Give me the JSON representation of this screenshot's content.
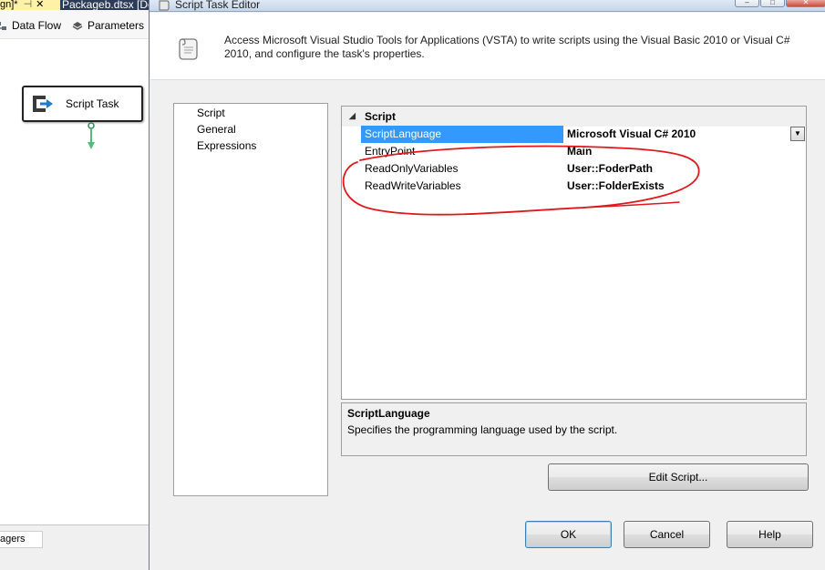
{
  "ide": {
    "tabs": [
      {
        "label": "gn]*"
      },
      {
        "label": "Packageb.dtsx [De"
      }
    ],
    "toolbar": {
      "data_flow": "Data Flow",
      "parameters": "Parameters"
    },
    "task": {
      "label": "Script Task"
    },
    "bottom_tab": "agers"
  },
  "dialog": {
    "title": "Script Task Editor",
    "description": "Access Microsoft Visual Studio Tools for Applications (VSTA) to write scripts using the Visual Basic 2010 or Visual C# 2010, and configure the task's properties.",
    "nav_items": [
      {
        "label": "Script"
      },
      {
        "label": "General"
      },
      {
        "label": "Expressions"
      }
    ],
    "grid": {
      "category": "Script",
      "rows": [
        {
          "name": "ScriptLanguage",
          "value": "Microsoft Visual C# 2010",
          "selected": true
        },
        {
          "name": "EntryPoint",
          "value": "Main"
        },
        {
          "name": "ReadOnlyVariables",
          "value": "User::FoderPath"
        },
        {
          "name": "ReadWriteVariables",
          "value": "User::FolderExists"
        }
      ]
    },
    "help": {
      "title": "ScriptLanguage",
      "text": "Specifies the programming language used by the script."
    },
    "buttons": {
      "edit_script": "Edit Script...",
      "ok": "OK",
      "cancel": "Cancel",
      "help": "Help"
    }
  },
  "colors": {
    "selection": "#3399ff",
    "annotation": "#e0171c",
    "ide_tab_bar": "#2b3b58",
    "ide_active_tab": "#fff1a8"
  }
}
